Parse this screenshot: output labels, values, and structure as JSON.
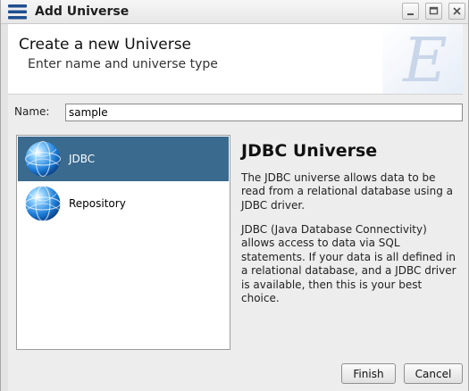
{
  "window": {
    "title": "Add Universe",
    "controls": [
      "minimize",
      "maximize",
      "close"
    ]
  },
  "banner": {
    "title": "Create a new Universe",
    "subtitle": "Enter name and universe type",
    "watermark": "E"
  },
  "name": {
    "label": "Name:",
    "value": "sample"
  },
  "universe_types": [
    {
      "label": "JDBC",
      "icon": "globe-icon",
      "selected": true
    },
    {
      "label": "Repository",
      "icon": "globe-icon",
      "selected": false
    }
  ],
  "description": {
    "title": "JDBC Universe",
    "paragraphs": [
      "The JDBC universe allows data to be read from a relational database using a JDBC driver.",
      "JDBC (Java Database Connectivity) allows access to data via SQL statements. If your data is all defined in a relational database, and a JDBC driver is available, then this is your best choice."
    ]
  },
  "buttons": {
    "finish": "Finish",
    "cancel": "Cancel"
  },
  "colors": {
    "selection": "#3a6a8e",
    "title_bar": "#e7e7e7",
    "icon_blue": "#1f4f8f"
  }
}
